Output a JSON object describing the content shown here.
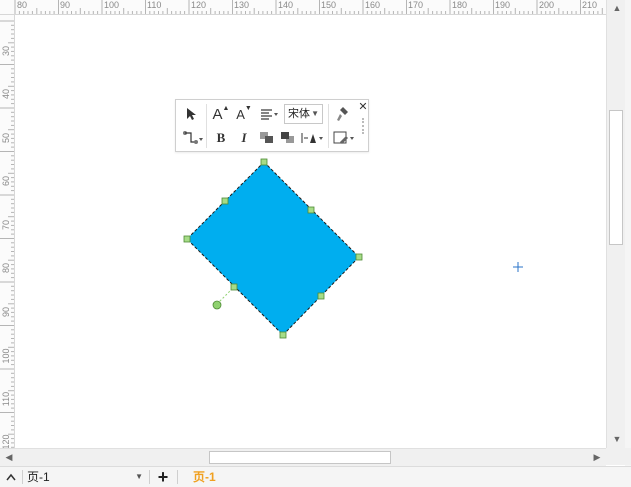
{
  "ruler": {
    "top_ticks": [
      "80",
      "90",
      "100",
      "110",
      "120",
      "130",
      "140",
      "150",
      "160",
      "170",
      "180",
      "190",
      "200",
      "210"
    ],
    "left_ticks": [
      "30",
      "40",
      "50",
      "60",
      "70",
      "80",
      "90",
      "100",
      "110",
      "120"
    ]
  },
  "toolbar": {
    "font_name": "宋体",
    "bold_label": "B",
    "italic_label": "I",
    "grow_font_label": "A",
    "shrink_font_label": "A"
  },
  "statusbar": {
    "page_selector": "页-1",
    "add_page_label": "+",
    "active_page_tab": "页-1",
    "active_tab_color": "#f0a020"
  },
  "shape": {
    "fill_color": "#00aeef",
    "handle_color": "#8fd16f"
  },
  "icons": [
    "pointer-icon",
    "grow-font-icon",
    "shrink-font-icon",
    "align-icon",
    "format-painter-icon",
    "close-icon",
    "connector-icon",
    "bold-icon",
    "italic-icon",
    "bring-front-icon",
    "send-back-icon",
    "text-position-icon",
    "line-style-icon",
    "chevron-up-icon",
    "chevron-down-icon",
    "plus-icon"
  ]
}
